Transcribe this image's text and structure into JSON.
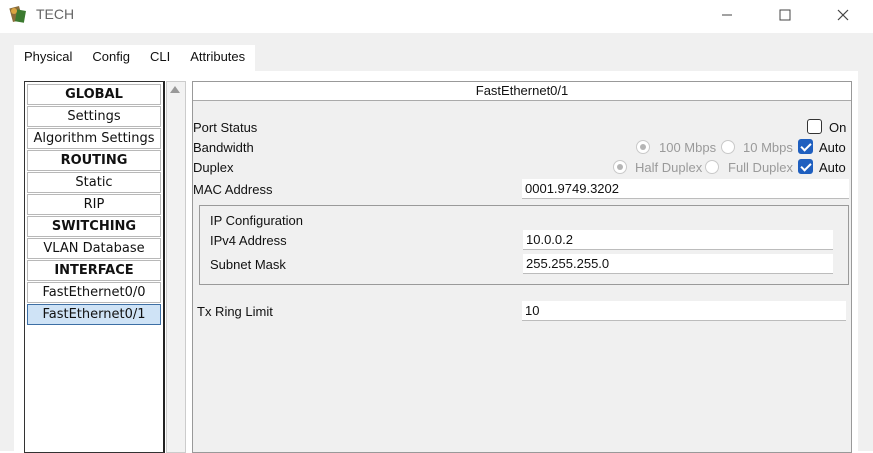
{
  "window": {
    "title": "TECH"
  },
  "tabs": [
    {
      "label": "Physical"
    },
    {
      "label": "Config"
    },
    {
      "label": "CLI"
    },
    {
      "label": "Attributes"
    }
  ],
  "sidebar": {
    "items": [
      {
        "label": "GLOBAL",
        "type": "header"
      },
      {
        "label": "Settings",
        "type": "item"
      },
      {
        "label": "Algorithm Settings",
        "type": "item"
      },
      {
        "label": "ROUTING",
        "type": "header"
      },
      {
        "label": "Static",
        "type": "item"
      },
      {
        "label": "RIP",
        "type": "item"
      },
      {
        "label": "SWITCHING",
        "type": "header"
      },
      {
        "label": "VLAN Database",
        "type": "item"
      },
      {
        "label": "INTERFACE",
        "type": "header"
      },
      {
        "label": "FastEthernet0/0",
        "type": "item"
      },
      {
        "label": "FastEthernet0/1",
        "type": "item",
        "selected": true
      }
    ]
  },
  "main": {
    "title": "FastEthernet0/1",
    "port_status": {
      "label": "Port Status",
      "on_label": "On",
      "checked": false
    },
    "bandwidth": {
      "label": "Bandwidth",
      "opt1": "100 Mbps",
      "opt2": "10 Mbps",
      "auto_label": "Auto",
      "auto_checked": true
    },
    "duplex": {
      "label": "Duplex",
      "opt1": "Half Duplex",
      "opt2": "Full Duplex",
      "auto_label": "Auto",
      "auto_checked": true
    },
    "mac": {
      "label": "MAC Address",
      "value": "0001.9749.3202"
    },
    "ip_config": {
      "title": "IP Configuration",
      "ipv4_label": "IPv4 Address",
      "ipv4_value": "10.0.0.2",
      "mask_label": "Subnet Mask",
      "mask_value": "255.255.255.0"
    },
    "tx_ring": {
      "label": "Tx Ring Limit",
      "value": "10"
    }
  },
  "colors": {
    "accent": "#1f5fbf",
    "tab_underline": "#1a3a5c",
    "selected_bg": "#cfe3f6"
  }
}
